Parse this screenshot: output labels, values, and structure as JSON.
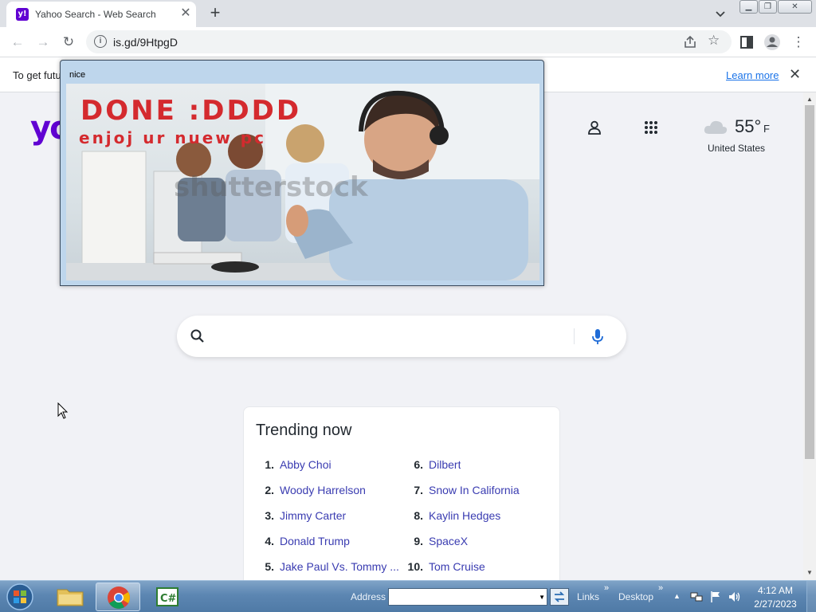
{
  "browser": {
    "tab_title": "Yahoo Search - Web Search",
    "tab_favicon": "y!",
    "url": "is.gd/9HtpgD",
    "infobar_text": "To get futu",
    "infobar_link": "Learn more"
  },
  "header": {
    "logo": "yo",
    "temperature": "55°",
    "temperature_unit": "F",
    "location": "United States"
  },
  "search": {
    "value": "",
    "placeholder": ""
  },
  "trending": {
    "title": "Trending now",
    "items": [
      {
        "num": "1.",
        "label": "Abby Choi"
      },
      {
        "num": "2.",
        "label": "Woody Harrelson"
      },
      {
        "num": "3.",
        "label": "Jimmy Carter"
      },
      {
        "num": "4.",
        "label": "Donald Trump"
      },
      {
        "num": "5.",
        "label": "Jake Paul Vs. Tommy ..."
      },
      {
        "num": "6.",
        "label": "Dilbert"
      },
      {
        "num": "7.",
        "label": "Snow In California"
      },
      {
        "num": "8.",
        "label": "Kaylin Hedges"
      },
      {
        "num": "9.",
        "label": "SpaceX"
      },
      {
        "num": "10.",
        "label": "Tom Cruise"
      }
    ]
  },
  "popup": {
    "title": "nice",
    "caption_line1": "DONE :DDDD",
    "caption_line2": "enjoj ur nuew pc",
    "watermark": "shutterstock"
  },
  "taskbar": {
    "address_label": "Address",
    "links_label": "Links",
    "desktop_label": "Desktop",
    "chevron": "»",
    "time": "4:12 AM",
    "date": "2/27/2023",
    "cs_icon_text": "C#"
  },
  "colors": {
    "yahoo_purple": "#6001d2",
    "trend_link": "#3a3cb1",
    "caption_red": "#d42a2e"
  },
  "icons": [
    "back-arrow-icon",
    "forward-arrow-icon",
    "reload-icon",
    "info-icon",
    "share-icon",
    "star-icon",
    "side-panel-icon",
    "profile-icon",
    "kebab-menu-icon",
    "user-icon",
    "apps-grid-icon",
    "cloud-icon",
    "search-icon",
    "mic-icon",
    "windows-start-icon",
    "folder-icon",
    "chrome-icon",
    "csharp-icon",
    "network-icon",
    "flag-icon",
    "volume-icon"
  ]
}
